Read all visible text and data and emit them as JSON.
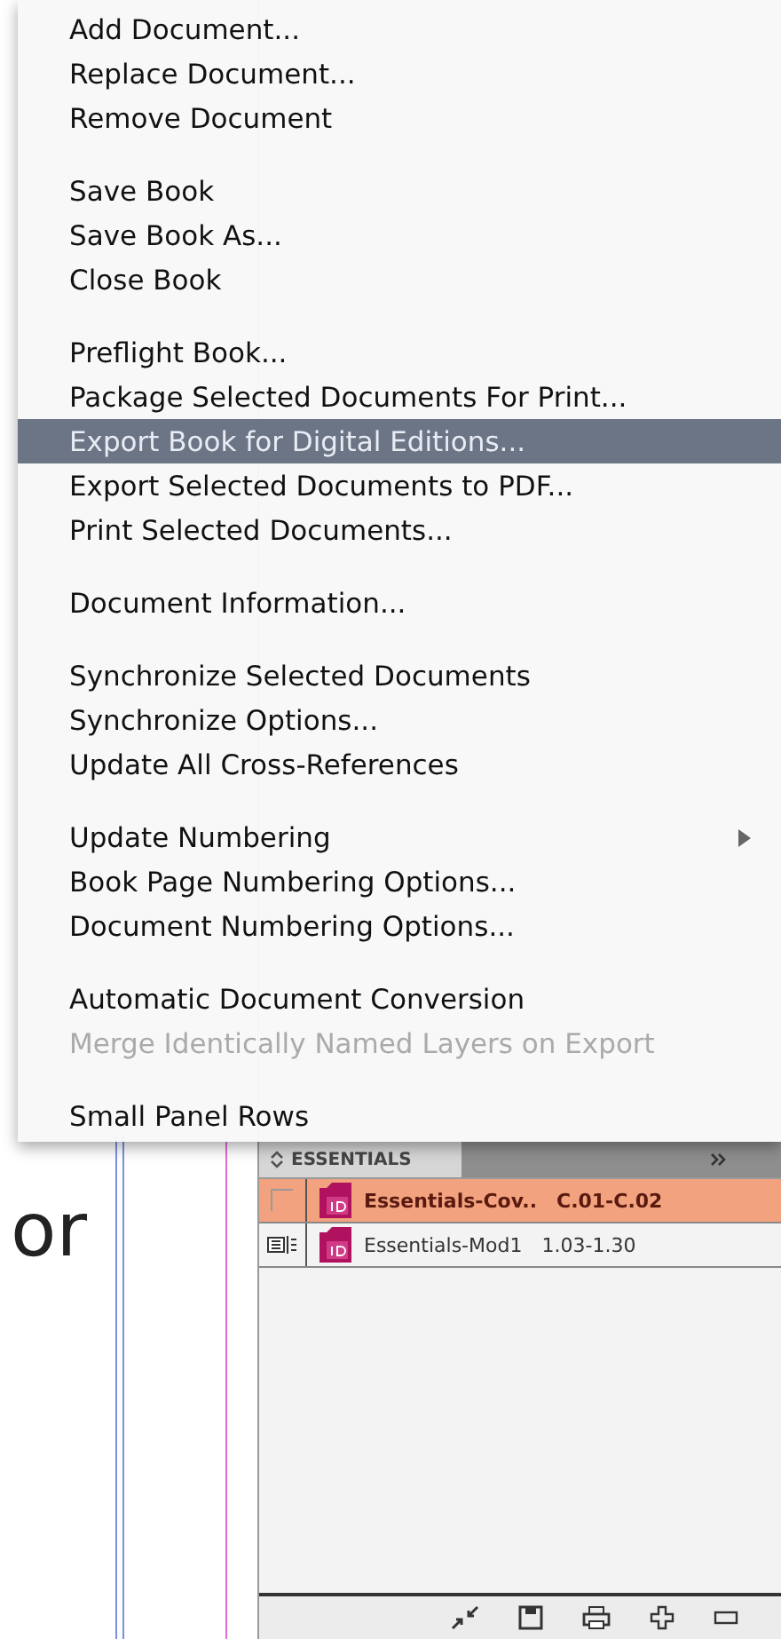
{
  "canvas": {
    "text": "or"
  },
  "book_panel": {
    "tab": "ESSENTIALS",
    "documents": [
      {
        "name": "Essentials-Cov..",
        "pages": "C.01-C.02",
        "selected": true,
        "style_source": false
      },
      {
        "name": "Essentials-Mod1",
        "pages": "1.03-1.30",
        "selected": false,
        "style_source": true
      }
    ]
  },
  "menu": {
    "groups": [
      {
        "items": [
          {
            "label": "Add Document...",
            "selected": false,
            "disabled": false,
            "submenu": false
          },
          {
            "label": "Replace Document...",
            "selected": false,
            "disabled": false,
            "submenu": false
          },
          {
            "label": "Remove Document",
            "selected": false,
            "disabled": false,
            "submenu": false
          }
        ]
      },
      {
        "items": [
          {
            "label": "Save Book",
            "selected": false,
            "disabled": false,
            "submenu": false
          },
          {
            "label": "Save Book As...",
            "selected": false,
            "disabled": false,
            "submenu": false
          },
          {
            "label": "Close Book",
            "selected": false,
            "disabled": false,
            "submenu": false
          }
        ]
      },
      {
        "items": [
          {
            "label": "Preflight Book...",
            "selected": false,
            "disabled": false,
            "submenu": false
          },
          {
            "label": "Package Selected Documents For Print...",
            "selected": false,
            "disabled": false,
            "submenu": false
          },
          {
            "label": "Export Book for Digital Editions...",
            "selected": true,
            "disabled": false,
            "submenu": false
          },
          {
            "label": "Export Selected Documents to PDF...",
            "selected": false,
            "disabled": false,
            "submenu": false
          },
          {
            "label": "Print Selected Documents...",
            "selected": false,
            "disabled": false,
            "submenu": false
          }
        ]
      },
      {
        "items": [
          {
            "label": "Document Information...",
            "selected": false,
            "disabled": false,
            "submenu": false
          }
        ]
      },
      {
        "items": [
          {
            "label": "Synchronize Selected Documents",
            "selected": false,
            "disabled": false,
            "submenu": false
          },
          {
            "label": "Synchronize Options...",
            "selected": false,
            "disabled": false,
            "submenu": false
          },
          {
            "label": "Update All Cross-References",
            "selected": false,
            "disabled": false,
            "submenu": false
          }
        ]
      },
      {
        "items": [
          {
            "label": "Update Numbering",
            "selected": false,
            "disabled": false,
            "submenu": true
          },
          {
            "label": "Book Page Numbering Options...",
            "selected": false,
            "disabled": false,
            "submenu": false
          },
          {
            "label": "Document Numbering Options...",
            "selected": false,
            "disabled": false,
            "submenu": false
          }
        ]
      },
      {
        "items": [
          {
            "label": "Automatic Document Conversion",
            "selected": false,
            "disabled": false,
            "submenu": false
          },
          {
            "label": "Merge Identically Named Layers on Export",
            "selected": false,
            "disabled": true,
            "submenu": false
          }
        ]
      },
      {
        "items": [
          {
            "label": "Small Panel Rows",
            "selected": false,
            "disabled": false,
            "submenu": false
          }
        ]
      }
    ]
  }
}
